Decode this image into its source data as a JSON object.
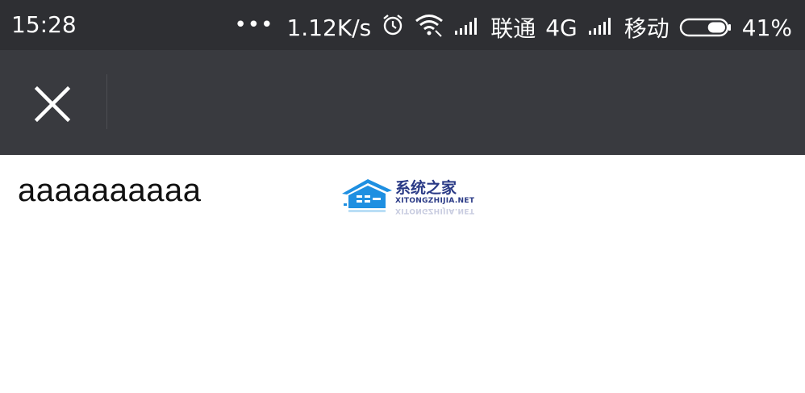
{
  "status_bar": {
    "time": "15:28",
    "more_dots": "•••",
    "network_speed": "1.12K/s",
    "carrier1": "联通",
    "network_type": "4G",
    "carrier2": "移动",
    "battery_percent": "41%",
    "battery_level": 0.41,
    "icons": [
      "alarm-icon",
      "wifi-icon",
      "signal-icon",
      "signal-icon",
      "battery-icon"
    ]
  },
  "nav_bar": {
    "close_icon": "close-icon",
    "background": "#393a3f"
  },
  "content": {
    "text": "aaaaaaaaaa"
  },
  "watermark": {
    "title_cn": "系统之家",
    "site": "XITONGZHIJIA.NET",
    "brand_color": "#1e8fe1"
  }
}
